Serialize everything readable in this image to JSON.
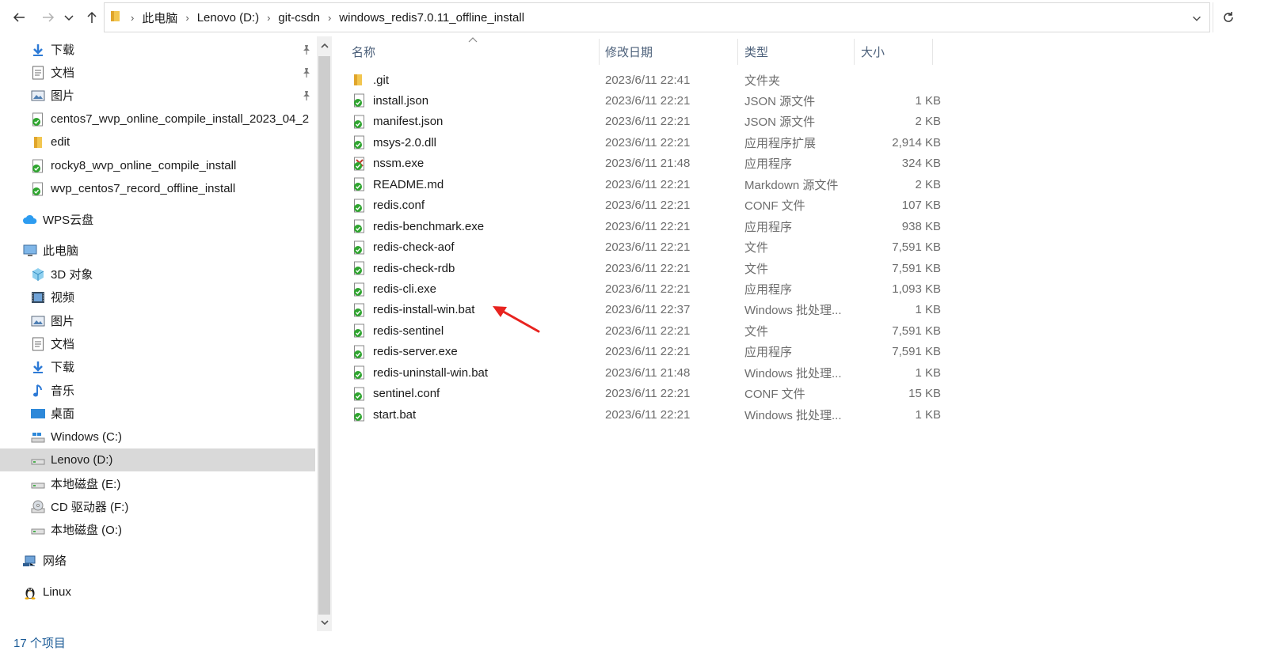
{
  "address_bar": {
    "breadcrumbs": [
      "此电脑",
      "Lenovo (D:)",
      "git-csdn",
      "windows_redis7.0.11_offline_install"
    ]
  },
  "nav": {
    "items": [
      {
        "label": "下载",
        "icon": "download-icon",
        "pinned": true
      },
      {
        "label": "文档",
        "icon": "document-icon",
        "pinned": true
      },
      {
        "label": "图片",
        "icon": "picture-icon",
        "pinned": true
      },
      {
        "label": "centos7_wvp_online_compile_install_2023_04_2",
        "icon": "git-folder-icon",
        "pinned": false
      },
      {
        "label": "edit",
        "icon": "folder-icon",
        "pinned": false
      },
      {
        "label": "rocky8_wvp_online_compile_install",
        "icon": "git-folder-icon",
        "pinned": false
      },
      {
        "label": "wvp_centos7_record_offline_install",
        "icon": "git-folder-icon",
        "pinned": false
      },
      {
        "label": "WPS云盘",
        "icon": "cloud-icon",
        "pinned": false
      },
      {
        "label": "此电脑",
        "icon": "computer-icon",
        "pinned": false
      },
      {
        "label": "3D 对象",
        "icon": "cube-icon",
        "pinned": false
      },
      {
        "label": "视频",
        "icon": "video-icon",
        "pinned": false
      },
      {
        "label": "图片",
        "icon": "picture-icon",
        "pinned": false
      },
      {
        "label": "文档",
        "icon": "document-icon",
        "pinned": false
      },
      {
        "label": "下载",
        "icon": "download-icon",
        "pinned": false
      },
      {
        "label": "音乐",
        "icon": "music-icon",
        "pinned": false
      },
      {
        "label": "桌面",
        "icon": "desktop-icon",
        "pinned": false
      },
      {
        "label": "Windows (C:)",
        "icon": "windows-drive-icon",
        "pinned": false
      },
      {
        "label": "Lenovo (D:)",
        "icon": "drive-icon",
        "pinned": false,
        "selected": true
      },
      {
        "label": "本地磁盘 (E:)",
        "icon": "drive-icon",
        "pinned": false
      },
      {
        "label": "CD 驱动器 (F:)",
        "icon": "cd-drive-icon",
        "pinned": false
      },
      {
        "label": "本地磁盘 (O:)",
        "icon": "drive-icon",
        "pinned": false
      },
      {
        "label": "网络",
        "icon": "network-icon",
        "pinned": false
      },
      {
        "label": "Linux",
        "icon": "linux-icon",
        "pinned": false
      }
    ]
  },
  "columns": {
    "name": "名称",
    "modified": "修改日期",
    "type": "类型",
    "size": "大小"
  },
  "files": [
    {
      "name": ".git",
      "modified": "2023/6/11 22:41",
      "type": "文件夹",
      "size": "",
      "icon": "folder-icon"
    },
    {
      "name": "install.json",
      "modified": "2023/6/11 22:21",
      "type": "JSON 源文件",
      "size": "1 KB",
      "icon": "git-file-icon"
    },
    {
      "name": "manifest.json",
      "modified": "2023/6/11 22:21",
      "type": "JSON 源文件",
      "size": "2 KB",
      "icon": "git-file-icon"
    },
    {
      "name": "msys-2.0.dll",
      "modified": "2023/6/11 22:21",
      "type": "应用程序扩展",
      "size": "2,914 KB",
      "icon": "git-file-icon"
    },
    {
      "name": "nssm.exe",
      "modified": "2023/6/11 21:48",
      "type": "应用程序",
      "size": "324 KB",
      "icon": "git-exe-icon"
    },
    {
      "name": "README.md",
      "modified": "2023/6/11 22:21",
      "type": "Markdown 源文件",
      "size": "2 KB",
      "icon": "git-file-icon"
    },
    {
      "name": "redis.conf",
      "modified": "2023/6/11 22:21",
      "type": "CONF 文件",
      "size": "107 KB",
      "icon": "git-file-icon"
    },
    {
      "name": "redis-benchmark.exe",
      "modified": "2023/6/11 22:21",
      "type": "应用程序",
      "size": "938 KB",
      "icon": "git-file-icon"
    },
    {
      "name": "redis-check-aof",
      "modified": "2023/6/11 22:21",
      "type": "文件",
      "size": "7,591 KB",
      "icon": "git-file-icon"
    },
    {
      "name": "redis-check-rdb",
      "modified": "2023/6/11 22:21",
      "type": "文件",
      "size": "7,591 KB",
      "icon": "git-file-icon"
    },
    {
      "name": "redis-cli.exe",
      "modified": "2023/6/11 22:21",
      "type": "应用程序",
      "size": "1,093 KB",
      "icon": "git-file-icon"
    },
    {
      "name": "redis-install-win.bat",
      "modified": "2023/6/11 22:37",
      "type": "Windows 批处理...",
      "size": "1 KB",
      "icon": "git-file-icon"
    },
    {
      "name": "redis-sentinel",
      "modified": "2023/6/11 22:21",
      "type": "文件",
      "size": "7,591 KB",
      "icon": "git-file-icon"
    },
    {
      "name": "redis-server.exe",
      "modified": "2023/6/11 22:21",
      "type": "应用程序",
      "size": "7,591 KB",
      "icon": "git-file-icon"
    },
    {
      "name": "redis-uninstall-win.bat",
      "modified": "2023/6/11 21:48",
      "type": "Windows 批处理...",
      "size": "1 KB",
      "icon": "git-file-icon"
    },
    {
      "name": "sentinel.conf",
      "modified": "2023/6/11 22:21",
      "type": "CONF 文件",
      "size": "15 KB",
      "icon": "git-file-icon"
    },
    {
      "name": "start.bat",
      "modified": "2023/6/11 22:21",
      "type": "Windows 批处理...",
      "size": "1 KB",
      "icon": "git-file-icon"
    }
  ],
  "status_bar": {
    "item_count": "17 个项目"
  },
  "colors": {
    "selected_bg": "#d9d9d9",
    "header_text": "#4c607a",
    "annotation_arrow": "#e8231f",
    "git_green": "#2fa52f"
  }
}
